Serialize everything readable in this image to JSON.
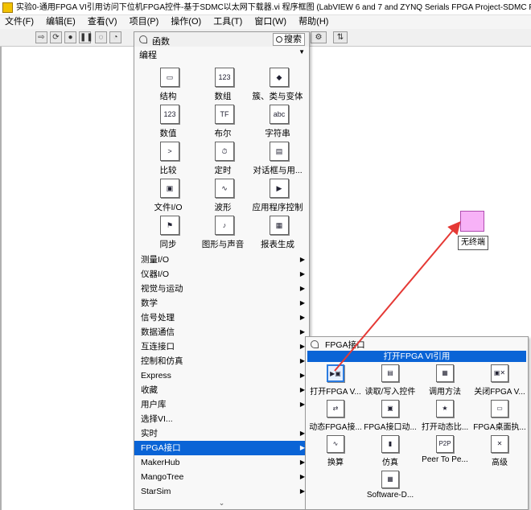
{
  "window": {
    "title": "实验0-通用FPGA VI引用访问下位机FPGA控件-基于SDMC以太网下载器.vi 程序框图 (LabVIEW 6 and 7 and ZYNQ Serials FPGA Project-SDMC FPGA D"
  },
  "menu": [
    "文件(F)",
    "编辑(E)",
    "查看(V)",
    "项目(P)",
    "操作(O)",
    "工具(T)",
    "窗口(W)",
    "帮助(H)"
  ],
  "palette": {
    "title": "函数",
    "search_label": "搜索",
    "category": "编程",
    "grid": [
      {
        "label": "结构",
        "icon": "structures-icon"
      },
      {
        "label": "数组",
        "icon": "array-icon"
      },
      {
        "label": "簇、类与变体",
        "icon": "cluster-icon"
      },
      {
        "label": "数值",
        "icon": "numeric-icon"
      },
      {
        "label": "布尔",
        "icon": "boolean-icon"
      },
      {
        "label": "字符串",
        "icon": "string-icon"
      },
      {
        "label": "比较",
        "icon": "comparison-icon"
      },
      {
        "label": "定时",
        "icon": "timing-icon"
      },
      {
        "label": "对话框与用...",
        "icon": "dialog-icon"
      },
      {
        "label": "文件I/O",
        "icon": "file-io-icon"
      },
      {
        "label": "波形",
        "icon": "waveform-icon"
      },
      {
        "label": "应用程序控制",
        "icon": "app-control-icon"
      },
      {
        "label": "同步",
        "icon": "sync-icon"
      },
      {
        "label": "图形与声音",
        "icon": "graphics-sound-icon"
      },
      {
        "label": "报表生成",
        "icon": "report-icon"
      }
    ],
    "categories": [
      {
        "label": "测量I/O",
        "arrow": true
      },
      {
        "label": "仪器I/O",
        "arrow": true
      },
      {
        "label": "视觉与运动",
        "arrow": true
      },
      {
        "label": "数学",
        "arrow": true
      },
      {
        "label": "信号处理",
        "arrow": true
      },
      {
        "label": "数据通信",
        "arrow": true
      },
      {
        "label": "互连接口",
        "arrow": true
      },
      {
        "label": "控制和仿真",
        "arrow": true
      },
      {
        "label": "Express",
        "arrow": true
      },
      {
        "label": "收藏",
        "arrow": true
      },
      {
        "label": "用户库",
        "arrow": true
      },
      {
        "label": "选择VI...",
        "arrow": false
      },
      {
        "label": "实时",
        "arrow": true
      },
      {
        "label": "FPGA接口",
        "arrow": true,
        "selected": true
      },
      {
        "label": "MakerHub",
        "arrow": true
      },
      {
        "label": "MangoTree",
        "arrow": true
      },
      {
        "label": "StarSim",
        "arrow": true
      }
    ]
  },
  "subpalette": {
    "title": "FPGA接口",
    "selected_item": "打开FPGA VI引用",
    "items": [
      {
        "label": "打开FPGA V...",
        "icon": "open-fpga-ref-icon",
        "highlight": true
      },
      {
        "label": "读取/写入控件",
        "icon": "read-write-control-icon"
      },
      {
        "label": "调用方法",
        "icon": "invoke-method-icon"
      },
      {
        "label": "关闭FPGA V...",
        "icon": "close-fpga-ref-icon"
      },
      {
        "label": "动态FPGA接...",
        "icon": "dynamic-fpga-icon"
      },
      {
        "label": "FPGA接口动...",
        "icon": "fpga-interface-dyn-icon"
      },
      {
        "label": "打开动态比...",
        "icon": "open-dynamic-bitfile-icon"
      },
      {
        "label": "FPGA桌面执...",
        "icon": "fpga-desktop-exec-icon"
      },
      {
        "label": "换算",
        "icon": "conversion-icon"
      },
      {
        "label": "仿真",
        "icon": "simulation-icon"
      },
      {
        "label": "Peer To Pe...",
        "icon": "p2p-icon"
      },
      {
        "label": "高级",
        "icon": "advanced-icon"
      },
      {
        "label": "Software-D...",
        "icon": "software-defined-icon"
      }
    ]
  },
  "canvas_node": {
    "label": "无终端"
  },
  "colors": {
    "selection": "#0a64d6",
    "arrow": "#e53935",
    "node": "#f7b2f7"
  }
}
